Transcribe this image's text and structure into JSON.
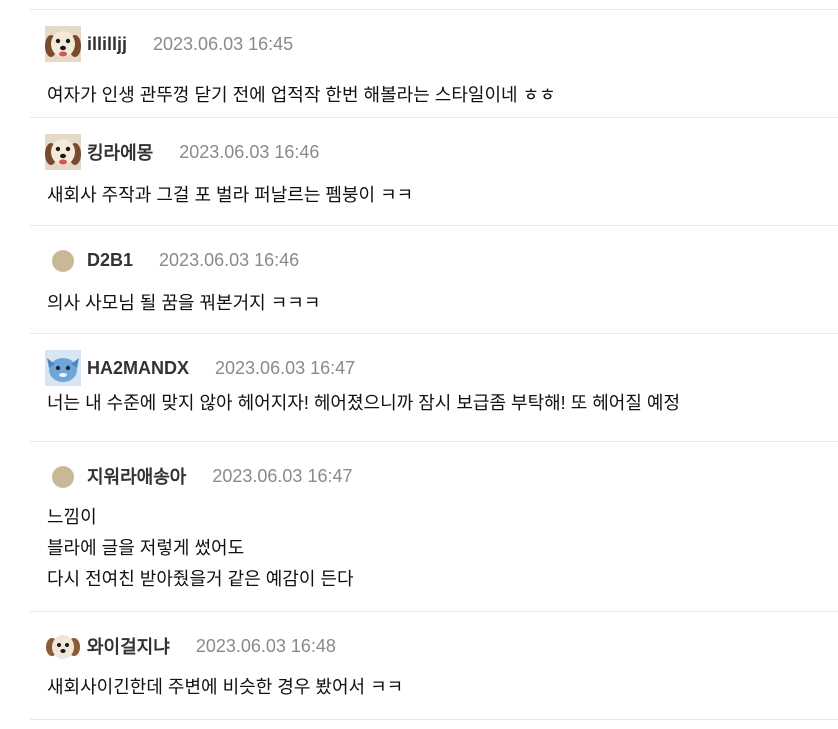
{
  "comments": [
    {
      "avatar": "dog-face-icon",
      "nickname": "illilljj",
      "datetime": "2023.06.03 16:45",
      "text": "여자가 인생 관뚜껑 닫기 전에 업적작 한번 해볼라는 스타일이네 ㅎㅎ"
    },
    {
      "avatar": "dog-face-icon",
      "nickname": "킹라에몽",
      "datetime": "2023.06.03 16:46",
      "text": "새회사 주작과 그걸 포 벌라 퍼날르는 펨붕이 ㅋㅋ"
    },
    {
      "avatar": "default-avatar-icon",
      "nickname": "D2B1",
      "datetime": "2023.06.03 16:46",
      "text": "의사 사모님 될 꿈을 꿔본거지 ㅋㅋㅋ"
    },
    {
      "avatar": "blue-creature-icon",
      "nickname": "HA2MANDX",
      "datetime": "2023.06.03 16:47",
      "text": "너는 내 수준에 맞지 않아 헤어지자! 헤어졌으니까 잠시 보급좀 부탁해! 또 헤어질 예정"
    },
    {
      "avatar": "default-avatar-icon",
      "nickname": "지워라애송아",
      "datetime": "2023.06.03 16:47",
      "text": "느낌이\n블라에 글을 저렇게 썼어도\n다시 전여친 받아줬을거 같은 예감이 든다"
    },
    {
      "avatar": "puppy-icon",
      "nickname": "와이걸지냐",
      "datetime": "2023.06.03 16:48",
      "text": "새회사이긴한데 주변에 비슷한 경우 봤어서 ㅋㅋ"
    }
  ],
  "colors": {
    "nickname": "#333333",
    "datetime": "#8a8a8a",
    "divider": "#e9e9e9",
    "default_avatar": "#c8b897"
  }
}
